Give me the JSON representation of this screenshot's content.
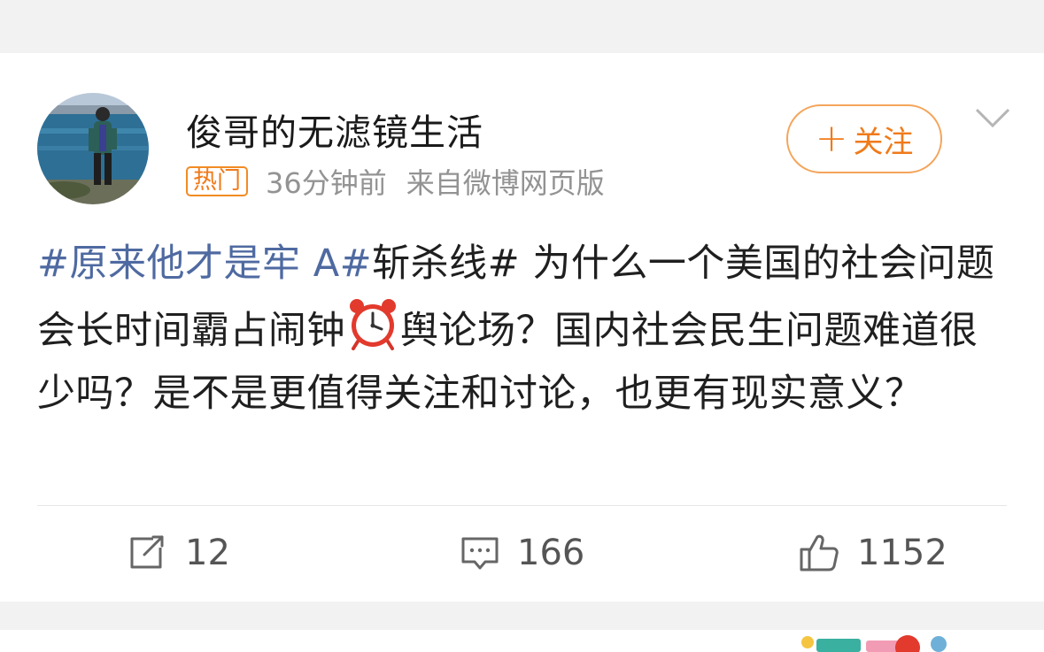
{
  "post": {
    "username": "俊哥的无滤镜生活",
    "badge": "热门",
    "time": "36分钟前",
    "source": "来自微博网页版",
    "follow_label": "关注",
    "text": {
      "tag1": "#原来他才是牢 A#",
      "tag2": "斩杀线#",
      "body1": " 为什么一个美国的社会问题会长时间霸占闹钟",
      "body2": "舆论场？国内社会民生问题难道很少吗？是不是更值得关注和讨论，也更有现实意义？"
    }
  },
  "actions": {
    "reposts": "12",
    "comments": "166",
    "likes": "1152"
  },
  "icons": {
    "more": "chevron-down-icon",
    "repost": "repost-icon",
    "comment": "comment-icon",
    "like": "thumbs-up-icon",
    "alarm": "alarm-clock-emoji"
  },
  "colors": {
    "accent_orange": "#f07a1a",
    "topic_blue": "#4f6aa1",
    "meta_gray": "#939393"
  }
}
